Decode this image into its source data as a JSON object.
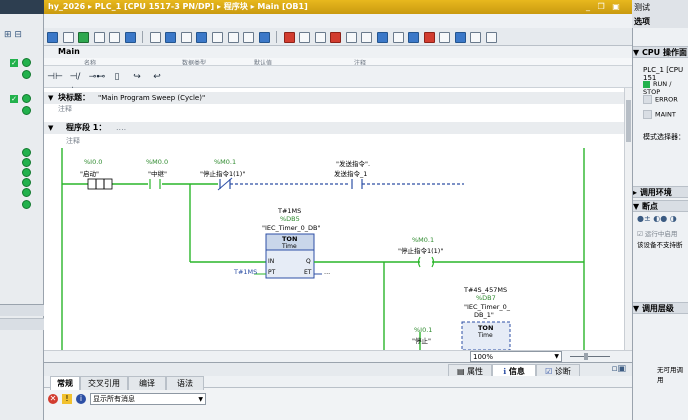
{
  "title": {
    "path": "hy_2026 ▸ PLC_1 [CPU 1517-3 PN/DP] ▸ 程序块 ▸ Main [OB1]"
  },
  "editor": {
    "block_title": "Main",
    "columns": [
      "名称",
      "数据类型",
      "默认值",
      "注释"
    ],
    "block_label": "块标题：",
    "block_value": "\"Main Program Sweep (Cycle)\"",
    "comment_label": "注释",
    "network_label": "程序段 1：",
    "network_value": "....",
    "network_comment": "注释"
  },
  "ladder": {
    "contact1": {
      "addr": "%I0.0",
      "name": "\"启动\""
    },
    "contact2": {
      "addr": "%M0.0",
      "name": "\"中继\""
    },
    "contact3": {
      "addr": "%M0.1",
      "name": "\"停止指令1(1)\""
    },
    "contact4": {
      "addr": "\"发送指令\".",
      "name": "发送指令_1"
    },
    "timer1": {
      "preset": "T#1MS",
      "db": "%DB5",
      "instance": "\"IEC_Timer_0_DB\"",
      "type": "TON",
      "sub": "Time",
      "in": "IN",
      "q": "Q",
      "pt": "PT",
      "et": "ET",
      "pt_value": "T#1MS",
      "et_value": "..."
    },
    "coil1": {
      "addr": "%M0.1",
      "name": "\"停止指令1(1)\""
    },
    "timer2": {
      "preset": "T#4S_457MS",
      "db": "%DB7",
      "instance": "\"IEC_Timer_0_",
      "instance2": "DB_1\"",
      "type": "TON",
      "sub": "Time"
    },
    "contact5": {
      "addr": "%I0.1",
      "name": "\"停止\""
    }
  },
  "zoom": "100%",
  "bottom": {
    "props_tabs": [
      "属性",
      "信息",
      "诊断"
    ],
    "info_tabs": [
      "常规",
      "交叉引用",
      "编译",
      "语法"
    ],
    "message_filter": "显示所有消息"
  },
  "right": {
    "top": "测试",
    "options": "选项",
    "cpu_panel": "CPU 操作面",
    "cpu_name": "PLC_1 [CPU 151",
    "leds": [
      "RUN / STOP",
      "ERROR",
      "MAINT"
    ],
    "mode": "模式选择器：",
    "call_env": "调用环境",
    "breakpoints": "断点",
    "run_note": "运行中启用",
    "unsupported": "该设备不支持断",
    "call_level": "调用层级",
    "none": "无可用调用"
  },
  "colors": {
    "accent": "#d4a017",
    "wire": "#2ab52a",
    "run": "#22b14c"
  }
}
